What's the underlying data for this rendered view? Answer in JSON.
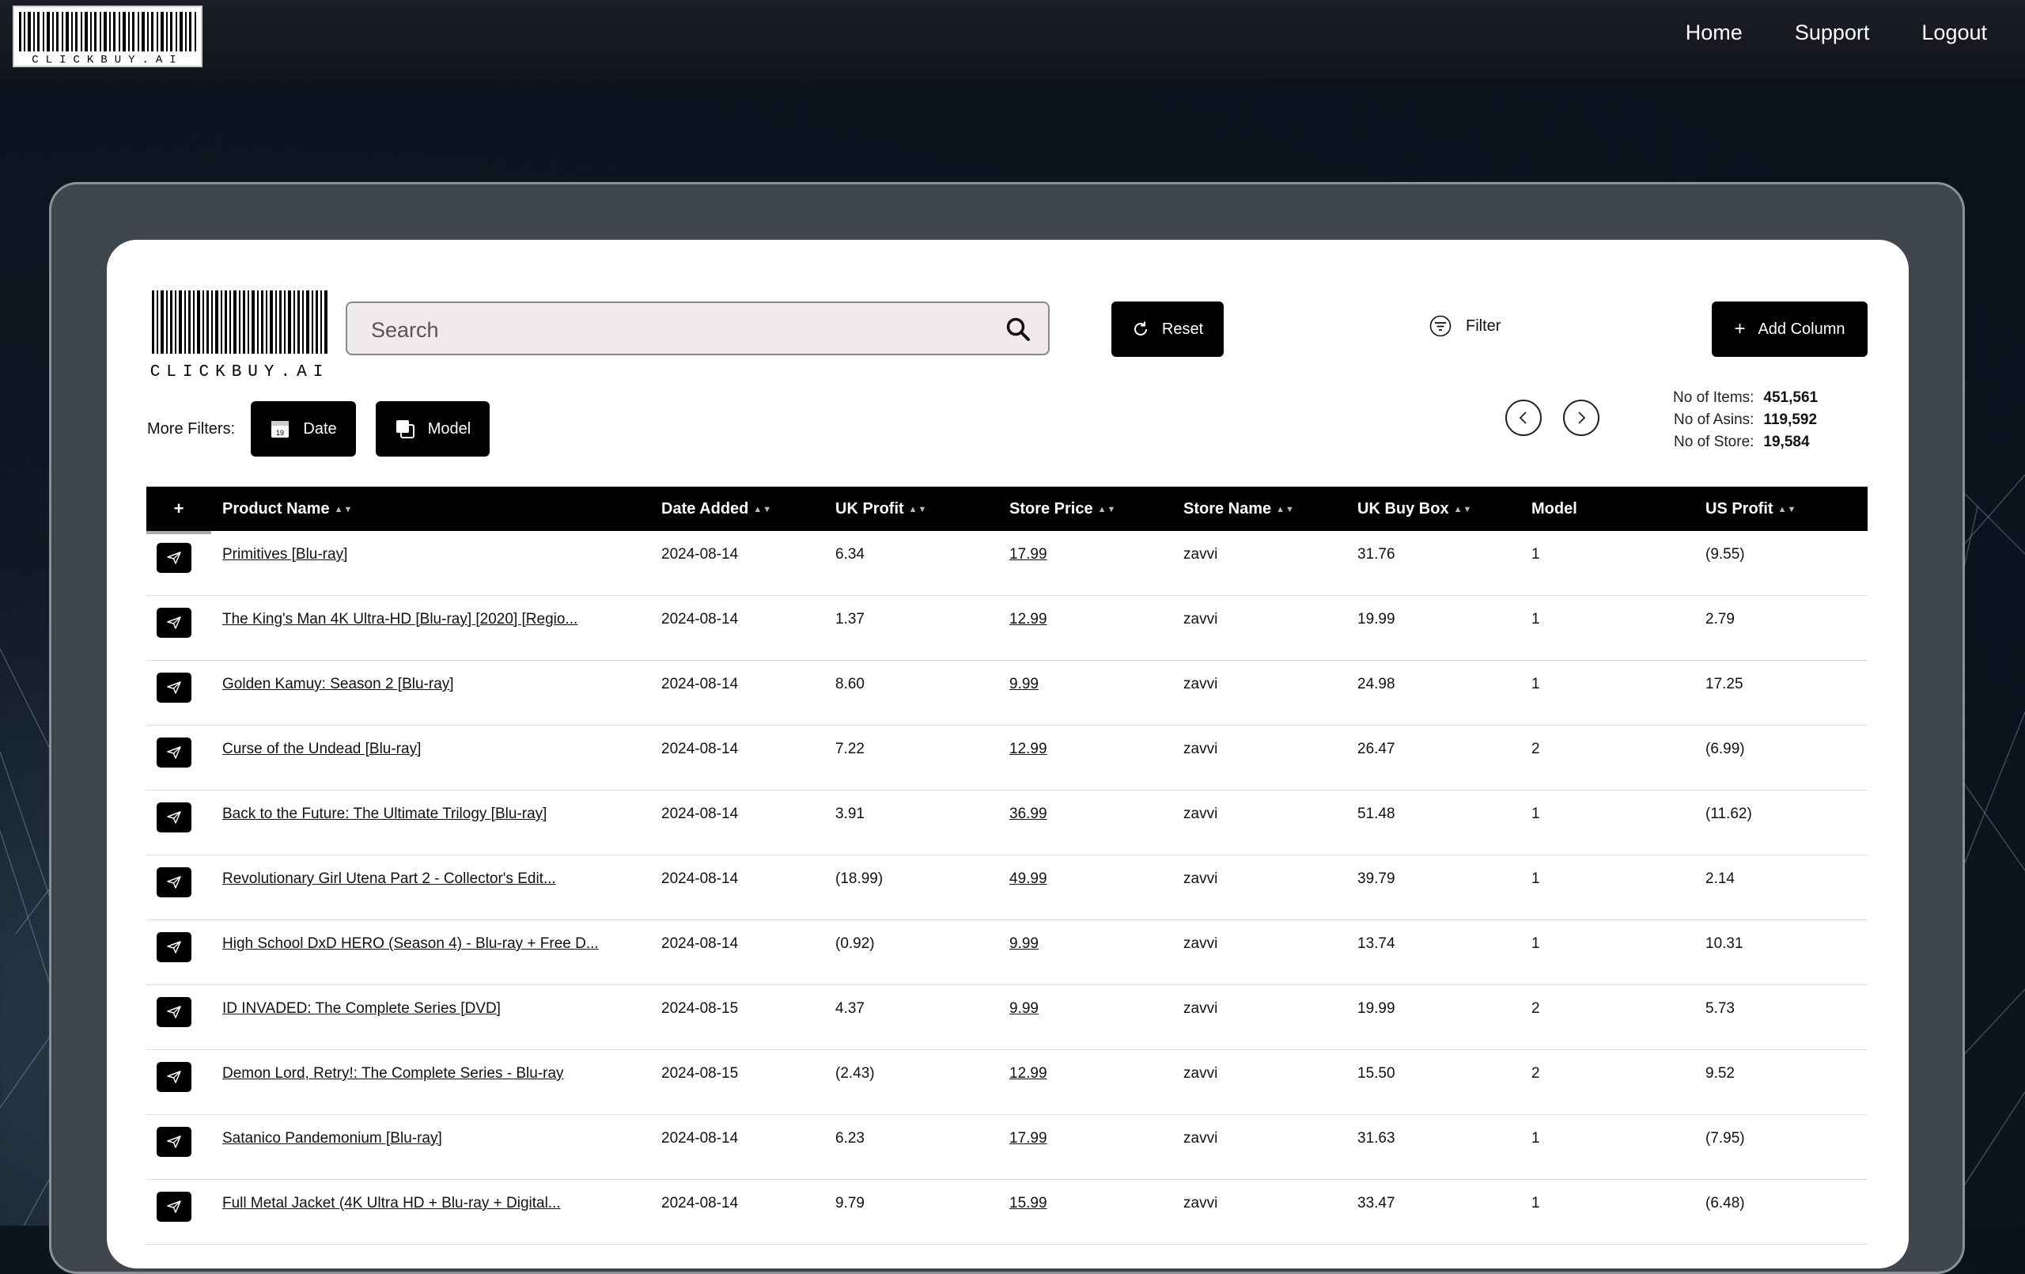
{
  "brand": "CLICKBUY.AI",
  "nav": [
    "Home",
    "Support",
    "Logout"
  ],
  "search": {
    "placeholder": "Search"
  },
  "buttons": {
    "reset": "Reset",
    "filter": "Filter",
    "add_column": "Add Column",
    "date": "Date",
    "model": "Model"
  },
  "more_filters_label": "More Filters:",
  "stats": [
    {
      "label": "No of Items:",
      "value": "451,561"
    },
    {
      "label": "No of Asins:",
      "value": "119,592"
    },
    {
      "label": "No of Store:",
      "value": "19,584"
    }
  ],
  "columns": {
    "plus": "+",
    "product_name": "Product Name",
    "date_added": "Date Added",
    "uk_profit": "UK Profit",
    "store_price": "Store Price",
    "store_name": "Store Name",
    "uk_buy_box": "UK Buy Box",
    "model": "Model",
    "us_profit": "US Profit"
  },
  "rows": [
    {
      "name": "Primitives [Blu-ray]",
      "date": "2024-08-14",
      "uk_profit": "6.34",
      "price": "17.99",
      "store": "zavvi",
      "buybox": "31.76",
      "model": "1",
      "us_profit": "(9.55)"
    },
    {
      "name": "The King's Man 4K Ultra-HD [Blu-ray] [2020] [Regio...",
      "date": "2024-08-14",
      "uk_profit": "1.37",
      "price": "12.99",
      "store": "zavvi",
      "buybox": "19.99",
      "model": "1",
      "us_profit": "2.79"
    },
    {
      "name": "Golden Kamuy: Season 2 [Blu-ray]",
      "date": "2024-08-14",
      "uk_profit": "8.60",
      "price": "9.99",
      "store": "zavvi",
      "buybox": "24.98",
      "model": "1",
      "us_profit": "17.25"
    },
    {
      "name": "Curse of the Undead [Blu-ray]",
      "date": "2024-08-14",
      "uk_profit": "7.22",
      "price": "12.99",
      "store": "zavvi",
      "buybox": "26.47",
      "model": "2",
      "us_profit": "(6.99)"
    },
    {
      "name": "Back to the Future: The Ultimate Trilogy [Blu-ray]",
      "date": "2024-08-14",
      "uk_profit": "3.91",
      "price": "36.99",
      "store": "zavvi",
      "buybox": "51.48",
      "model": "1",
      "us_profit": "(11.62)"
    },
    {
      "name": "Revolutionary Girl Utena Part 2 - Collector's Edit...",
      "date": "2024-08-14",
      "uk_profit": "(18.99)",
      "price": "49.99",
      "store": "zavvi",
      "buybox": "39.79",
      "model": "1",
      "us_profit": "2.14"
    },
    {
      "name": "High School DxD HERO (Season 4) - Blu-ray + Free D...",
      "date": "2024-08-14",
      "uk_profit": "(0.92)",
      "price": "9.99",
      "store": "zavvi",
      "buybox": "13.74",
      "model": "1",
      "us_profit": "10.31"
    },
    {
      "name": "ID INVADED: The Complete Series [DVD]",
      "date": "2024-08-15",
      "uk_profit": "4.37",
      "price": "9.99",
      "store": "zavvi",
      "buybox": "19.99",
      "model": "2",
      "us_profit": "5.73"
    },
    {
      "name": "Demon Lord, Retry!: The Complete Series - Blu-ray",
      "date": "2024-08-15",
      "uk_profit": "(2.43)",
      "price": "12.99",
      "store": "zavvi",
      "buybox": "15.50",
      "model": "2",
      "us_profit": "9.52"
    },
    {
      "name": "Satanico Pandemonium [Blu-ray]",
      "date": "2024-08-14",
      "uk_profit": "6.23",
      "price": "17.99",
      "store": "zavvi",
      "buybox": "31.63",
      "model": "1",
      "us_profit": "(7.95)"
    },
    {
      "name": "Full Metal Jacket (4K Ultra HD + Blu-ray + Digital...",
      "date": "2024-08-14",
      "uk_profit": "9.79",
      "price": "15.99",
      "store": "zavvi",
      "buybox": "33.47",
      "model": "1",
      "us_profit": "(6.48)"
    }
  ]
}
